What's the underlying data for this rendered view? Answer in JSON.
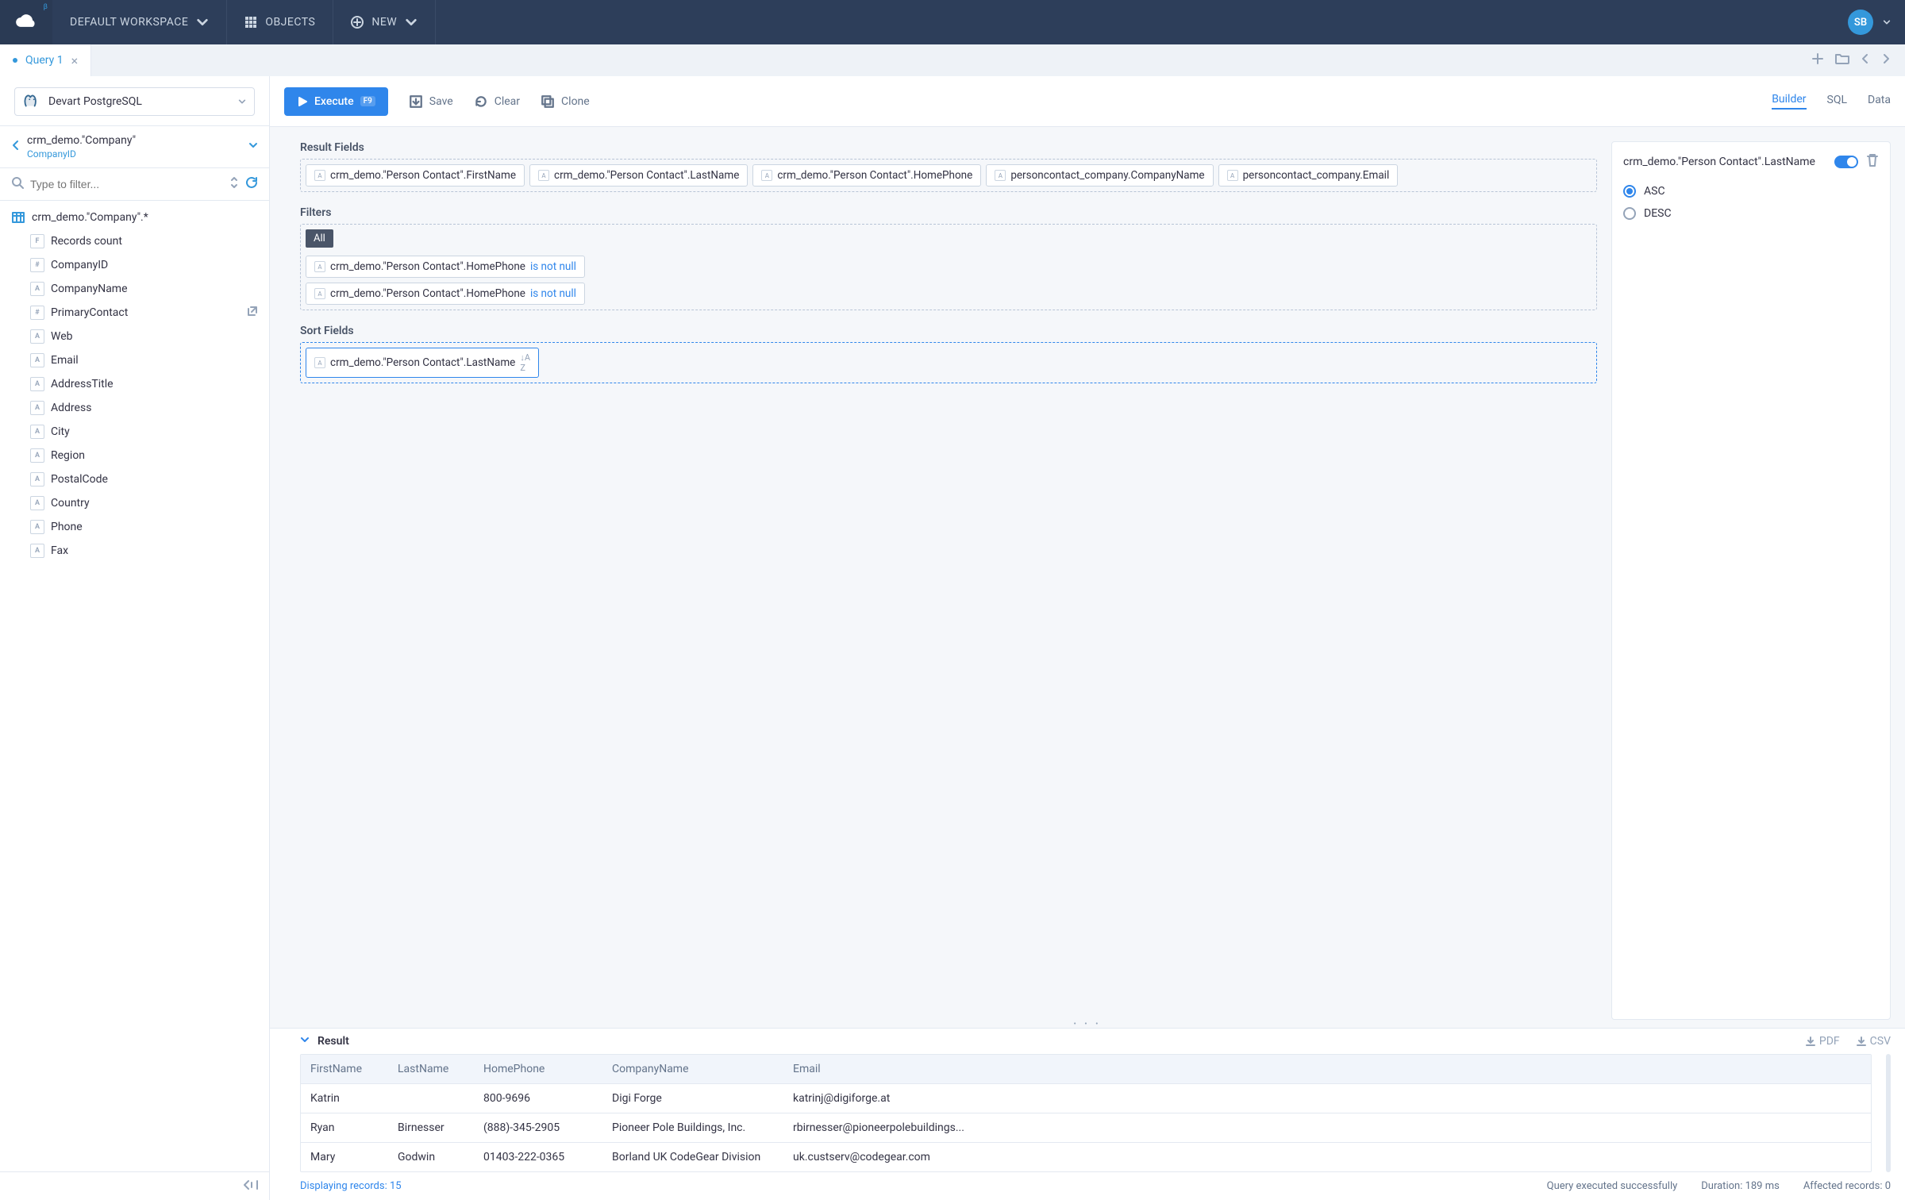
{
  "topnav": {
    "workspace": "DEFAULT WORKSPACE",
    "objects": "OBJECTS",
    "new": "NEW",
    "avatar_initials": "SB"
  },
  "tabs": [
    {
      "label": "Query 1"
    }
  ],
  "connection": {
    "label": "Devart PostgreSQL"
  },
  "breadcrumb": {
    "title": "crm_demo.\"Company\"",
    "subtitle": "CompanyID"
  },
  "filter_placeholder": "Type to filter...",
  "tree": {
    "root": "crm_demo.\"Company\".*",
    "fields": [
      {
        "type": "F",
        "label": "Records count"
      },
      {
        "type": "#",
        "label": "CompanyID"
      },
      {
        "type": "A",
        "label": "CompanyName"
      },
      {
        "type": "#",
        "label": "PrimaryContact",
        "link": true
      },
      {
        "type": "A",
        "label": "Web"
      },
      {
        "type": "A",
        "label": "Email"
      },
      {
        "type": "A",
        "label": "AddressTitle"
      },
      {
        "type": "A",
        "label": "Address"
      },
      {
        "type": "A",
        "label": "City"
      },
      {
        "type": "A",
        "label": "Region"
      },
      {
        "type": "A",
        "label": "PostalCode"
      },
      {
        "type": "A",
        "label": "Country"
      },
      {
        "type": "A",
        "label": "Phone"
      },
      {
        "type": "A",
        "label": "Fax"
      }
    ]
  },
  "toolbar": {
    "execute": "Execute",
    "execute_key": "F9",
    "save": "Save",
    "clear": "Clear",
    "clone": "Clone",
    "views": {
      "builder": "Builder",
      "sql": "SQL",
      "data": "Data"
    }
  },
  "builder": {
    "result_fields_title": "Result Fields",
    "result_fields": [
      "crm_demo.\"Person Contact\".FirstName",
      "crm_demo.\"Person Contact\".LastName",
      "crm_demo.\"Person Contact\".HomePhone",
      "personcontact_company.CompanyName",
      "personcontact_company.Email"
    ],
    "filters_title": "Filters",
    "filters_all": "All",
    "filters": [
      {
        "field": "crm_demo.\"Person Contact\".HomePhone",
        "op": "is not null"
      },
      {
        "field": "crm_demo.\"Person Contact\".HomePhone",
        "op": "is not null"
      }
    ],
    "sort_title": "Sort Fields",
    "sort_fields": [
      "crm_demo.\"Person Contact\".LastName"
    ]
  },
  "side_panel": {
    "field": "crm_demo.\"Person Contact\".LastName",
    "asc": "ASC",
    "desc": "DESC"
  },
  "result": {
    "title": "Result",
    "pdf": "PDF",
    "csv": "CSV",
    "columns": [
      "FirstName",
      "LastName",
      "HomePhone",
      "CompanyName",
      "Email"
    ],
    "rows": [
      [
        "Katrin",
        "",
        "800-9696",
        "Digi Forge",
        "katrinj@digiforge.at"
      ],
      [
        "Ryan",
        "Birnesser",
        "(888)-345-2905",
        "Pioneer Pole Buildings, Inc.",
        "rbirnesser@pioneerpolebuildings..."
      ],
      [
        "Mary",
        "Godwin",
        "01403-222-0365",
        "Borland UK CodeGear Division",
        "uk.custserv@codegear.com"
      ]
    ]
  },
  "status": {
    "displaying": "Displaying records: 15",
    "success": "Query executed successfully",
    "duration": "Duration: 189 ms",
    "affected": "Affected records: 0"
  }
}
